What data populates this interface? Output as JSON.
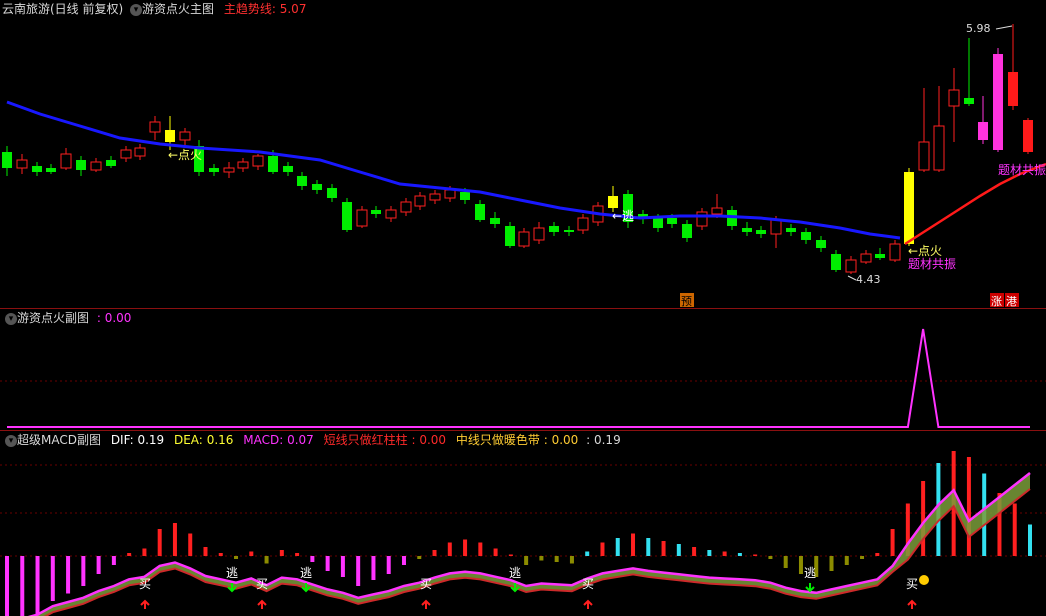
{
  "colors": {
    "background": "#000000",
    "up": "#ff2a2a",
    "down": "#00ff00",
    "trend": "#1818ff",
    "magenta": "#ff00ff",
    "yellow": "#ffff00",
    "cyan": "#33e0f0",
    "olive": "#8c8c00",
    "separator": "#8a1010"
  },
  "main_panel": {
    "stock_name": "云南旅游(日线 前复权)",
    "indicator_icon": "chevron-down-icon",
    "indicator_name": "游资点火主图",
    "trend_label": "主趋势线:",
    "trend_value": "5.07",
    "annotations": {
      "high_value": "5.98",
      "low_value": "4.43",
      "ignite_1": "←点火",
      "escape_1": "←逃",
      "ignite_2": "←点火",
      "theme_1": "题材共振",
      "theme_2": "题材共振"
    },
    "bottom_tags": {
      "pre": "预",
      "zhang": "涨",
      "gang": "港"
    }
  },
  "sub_panel_1": {
    "indicator_icon": "chevron-down-icon",
    "name": "游资点火副图",
    "value_prefix": ":",
    "value": "0.00"
  },
  "sub_panel_2": {
    "indicator_icon": "chevron-down-icon",
    "name": "超级MACD副图",
    "dif_label": "DIF:",
    "dif_value": "0.19",
    "dea_label": "DEA:",
    "dea_value": "0.16",
    "macd_label": "MACD:",
    "macd_value": "0.07",
    "short_label": "短线只做红柱柱",
    "short_value": ": 0.00",
    "mid_label": "中线只做暖色带",
    "mid_value": ": 0.00",
    "last_value": ": 0.19",
    "signals": {
      "buy": "买",
      "escape": "逃"
    }
  },
  "chart_data": [
    {
      "type": "candlestick",
      "title": "",
      "series": [
        {
          "name": "主趋势线",
          "values_description": "declining then rising trend line"
        }
      ],
      "ylim": [
        4.2,
        6.2
      ],
      "labels": [
        "5.98",
        "4.43"
      ]
    },
    {
      "type": "line",
      "title": "",
      "values": [
        0,
        0,
        0,
        0,
        0,
        0,
        0,
        0,
        0,
        0,
        0,
        0,
        0,
        0,
        0,
        0,
        0,
        0,
        0,
        0,
        0,
        0,
        0,
        0,
        0,
        0,
        0,
        0,
        0,
        0,
        0,
        0,
        0,
        0,
        0,
        0,
        0,
        0,
        0,
        0,
        0,
        0,
        0,
        0,
        0,
        0,
        0,
        0,
        0,
        0,
        0,
        0,
        0,
        0,
        0,
        0,
        0,
        0,
        0,
        0,
        1,
        0,
        0,
        0,
        0,
        0,
        0,
        0
      ]
    },
    {
      "type": "bar",
      "title": "",
      "values": [
        -0.05,
        -0.045,
        -0.04,
        -0.03,
        -0.025,
        -0.02,
        -0.012,
        -0.006,
        0.002,
        0.005,
        0.018,
        0.022,
        0.015,
        0.006,
        0.002,
        -0.002,
        0.003,
        -0.005,
        0.004,
        0.002,
        -0.004,
        -0.01,
        -0.014,
        -0.02,
        -0.016,
        -0.012,
        -0.006,
        -0.002,
        0.004,
        0.009,
        0.011,
        0.009,
        0.005,
        0.001,
        -0.006,
        -0.003,
        -0.004,
        -0.005,
        0.003,
        0.009,
        0.012,
        0.015,
        0.012,
        0.01,
        0.008,
        0.006,
        0.004,
        0.003,
        0.002,
        0.001,
        -0.002,
        -0.008,
        -0.012,
        -0.014,
        -0.01,
        -0.006,
        -0.002,
        0.002,
        0.018,
        0.035,
        0.05,
        0.062,
        0.07,
        0.066,
        0.055,
        0.042,
        0.035,
        0.021
      ]
    }
  ]
}
